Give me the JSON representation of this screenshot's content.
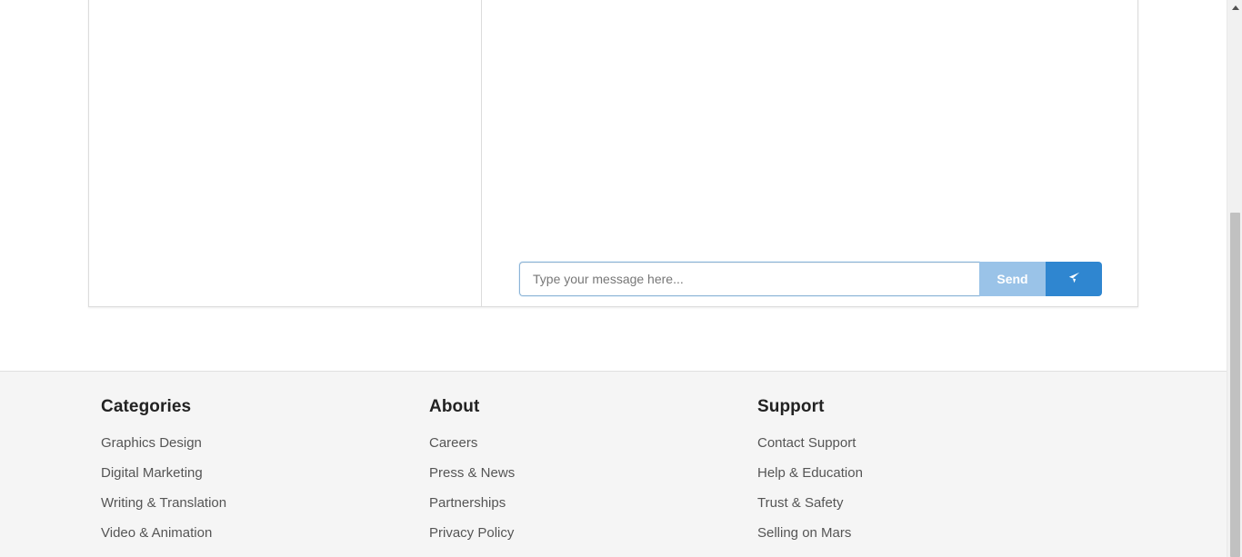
{
  "chat": {
    "input_placeholder": "Type your message here...",
    "send_label": "Send",
    "plane_icon": "paper-plane-icon"
  },
  "footer": {
    "categories": {
      "heading": "Categories",
      "links": [
        "Graphics Design",
        "Digital Marketing",
        "Writing & Translation",
        "Video & Animation"
      ]
    },
    "about": {
      "heading": "About",
      "links": [
        "Careers",
        "Press & News",
        "Partnerships",
        "Privacy Policy"
      ]
    },
    "support": {
      "heading": "Support",
      "links": [
        "Contact Support",
        "Help & Education",
        "Trust & Safety",
        "Selling on Mars"
      ]
    }
  },
  "colors": {
    "accent": "#2f86d0",
    "send_disabled": "#9ac3e8",
    "footer_bg": "#f5f5f5"
  }
}
